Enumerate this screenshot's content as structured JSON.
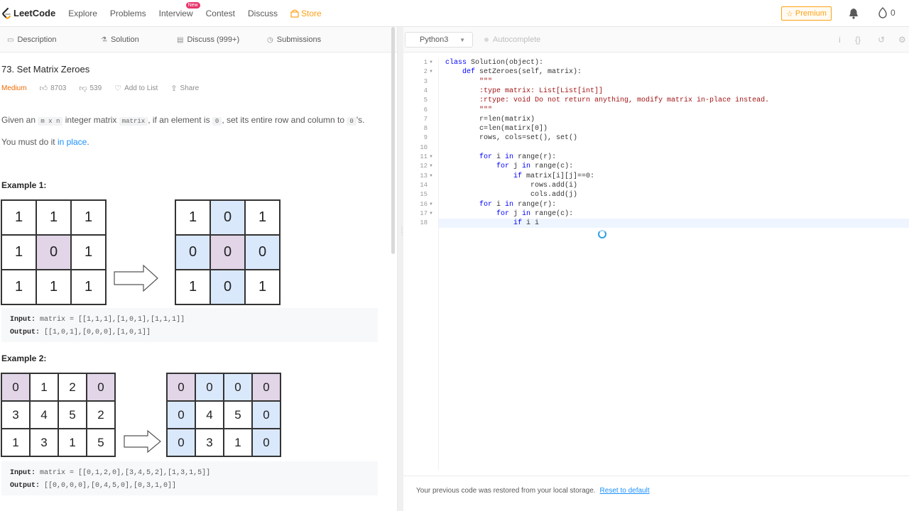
{
  "nav": {
    "logo": "LeetCode",
    "links": [
      "Explore",
      "Problems",
      "Interview",
      "Contest",
      "Discuss",
      "Store"
    ],
    "new_badge": "New",
    "premium": "Premium",
    "points": "0"
  },
  "left_tabs": [
    "Description",
    "Solution",
    "Discuss (999+)",
    "Submissions"
  ],
  "problem": {
    "title": "73. Set Matrix Zeroes",
    "difficulty": "Medium",
    "likes": "8703",
    "dislikes": "539",
    "add_to_list": "Add to List",
    "share": "Share",
    "desc_1": "Given an",
    "desc_code1": "m x n",
    "desc_2": "integer matrix",
    "desc_code2": "matrix",
    "desc_3": ", if an element is",
    "desc_code3": "0",
    "desc_4": ", set its entire row and column to",
    "desc_code4": "0",
    "desc_5": "'s.",
    "must_1": "You must do it",
    "must_link": "in place",
    "must_2": "."
  },
  "example1": {
    "title": "Example 1:",
    "input_label": "Input:",
    "input_value": "matrix = [[1,1,1],[1,0,1],[1,1,1]]",
    "output_label": "Output:",
    "output_value": "[[1,0,1],[0,0,0],[1,0,1]]",
    "before": [
      [
        "1",
        "1",
        "1"
      ],
      [
        "1",
        "0",
        "1"
      ],
      [
        "1",
        "1",
        "1"
      ]
    ],
    "before_hl": [
      [
        "",
        "",
        ""
      ],
      [
        "",
        "p",
        ""
      ],
      [
        "",
        "",
        ""
      ]
    ],
    "after": [
      [
        "1",
        "0",
        "1"
      ],
      [
        "0",
        "0",
        "0"
      ],
      [
        "1",
        "0",
        "1"
      ]
    ],
    "after_hl": [
      [
        "",
        "b",
        ""
      ],
      [
        "b",
        "p",
        "b"
      ],
      [
        "",
        "b",
        ""
      ]
    ]
  },
  "example2": {
    "title": "Example 2:",
    "input_label": "Input:",
    "input_value": "matrix = [[0,1,2,0],[3,4,5,2],[1,3,1,5]]",
    "output_label": "Output:",
    "output_value": "[[0,0,0,0],[0,4,5,0],[0,3,1,0]]",
    "before": [
      [
        "0",
        "1",
        "2",
        "0"
      ],
      [
        "3",
        "4",
        "5",
        "2"
      ],
      [
        "1",
        "3",
        "1",
        "5"
      ]
    ],
    "before_hl": [
      [
        "p",
        "",
        "",
        "p"
      ],
      [
        "",
        "",
        "",
        ""
      ],
      [
        "",
        "",
        "",
        ""
      ]
    ],
    "after": [
      [
        "0",
        "0",
        "0",
        "0"
      ],
      [
        "0",
        "4",
        "5",
        "0"
      ],
      [
        "0",
        "3",
        "1",
        "0"
      ]
    ],
    "after_hl": [
      [
        "p",
        "b",
        "b",
        "p"
      ],
      [
        "b",
        "",
        "",
        "b"
      ],
      [
        "b",
        "",
        "",
        "b"
      ]
    ]
  },
  "editor": {
    "language": "Python3",
    "autocomplete": "Autocomplete",
    "restore_msg": "Your previous code was restored from your local storage.",
    "reset": "Reset to default",
    "lines": [
      "class Solution(object):",
      "    def setZeroes(self, matrix):",
      "        \"\"\"",
      "        :type matrix: List[List[int]]",
      "        :rtype: void Do not return anything, modify matrix in-place instead.",
      "        \"\"\"",
      "        r=len(matrix)",
      "        c=len(matirx[0])",
      "        rows, cols=set(), set()",
      "",
      "        for i in range(r):",
      "            for j in range(c):",
      "                if matrix[i][j]==0:",
      "                    rows.add(i)",
      "                    cols.add(j)",
      "        for i in range(r):",
      "            for j in range(c):",
      "                if i i"
    ],
    "folds": [
      1,
      2,
      11,
      12,
      13,
      16,
      17
    ]
  },
  "colors": {
    "accent": "#ffa116",
    "link": "#1a90ff",
    "purple_cell": "#e1d5e7",
    "blue_cell": "#dae8fc",
    "medium": "#ef6c00"
  }
}
